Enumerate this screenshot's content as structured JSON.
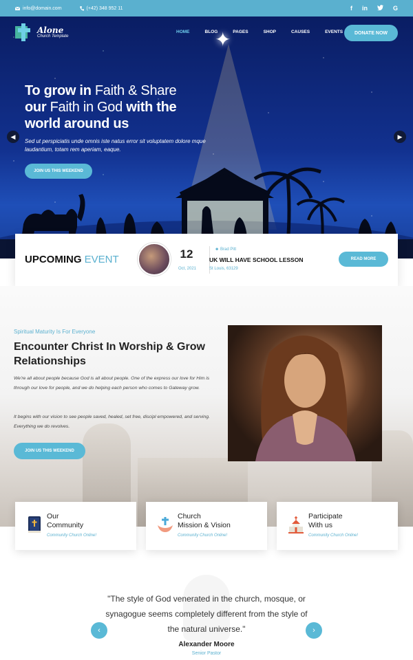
{
  "topbar": {
    "email": "info@domain.com",
    "phone": "(+42) 348 952 11",
    "social": [
      "f",
      "in",
      "t",
      "G"
    ]
  },
  "header": {
    "logo_title": "Alone",
    "logo_subtitle": "Church Template",
    "nav": [
      "HOME",
      "BLOG",
      "PAGES",
      "SHOP",
      "CAUSES",
      "EVENTS"
    ],
    "donate_label": "DONATE NOW"
  },
  "hero": {
    "line1_bold": "To grow in",
    "line1_normal": "Faith & Share",
    "line2_bold": "our",
    "line2_normal": "Faith in God",
    "line2_bold2": "with the",
    "line3_bold": "world around us",
    "subtext": "Sed ut perspiciatis unde omnis iste natus error sit voluptatem dolore mque laudantium, totam rem aperiam, eaque.",
    "cta_label": "JOIN US THIS WEEKEND"
  },
  "event": {
    "label_bold": "UPCOMING",
    "label_light": "EVENT",
    "day": "12",
    "month_year": "Oct, 2021",
    "author": "Brad Pitt",
    "title": "UK WILL HAVE SCHOOL LESSON",
    "location": "St Louis, 63129",
    "read_more": "READ MORE"
  },
  "about": {
    "eyebrow": "Spiritual Maturity Is For Everyone",
    "heading": "Encounter Christ In Worship & Grow Relationships",
    "para1": "We're all about people because God is all about people. One of the express our love for Him is through our love for people, and we do helping each person who comes to Gateway grow.",
    "para2": "It begins with our vision to see people saved, healed, set free, discipl empowered, and serving. Everything we do revolves.",
    "cta_label": "JOIN US THIS WEEKEND"
  },
  "cards": [
    {
      "title": "Our Community",
      "line1": "Our",
      "line2": "Community",
      "sub": "Community Church Online!",
      "icon": "bible-icon"
    },
    {
      "title": "Church Mission & Vision",
      "line1": "Church",
      "line2": "Mission & Vision",
      "sub": "Community Church Online!",
      "icon": "hands-cross-icon"
    },
    {
      "title": "Participate With us",
      "line1": "Participate",
      "line2": "With us",
      "sub": "Community Church Online!",
      "icon": "church-icon"
    }
  ],
  "testimonial": {
    "quote": "\"The style of God venerated in the church, mosque, or synagogue seems completely different from the style of the natural universe.\"",
    "name": "Alexander Moore",
    "role": "Senior Pastor"
  },
  "colors": {
    "accent": "#5ab0cf",
    "hero_sky": "#12318f"
  }
}
